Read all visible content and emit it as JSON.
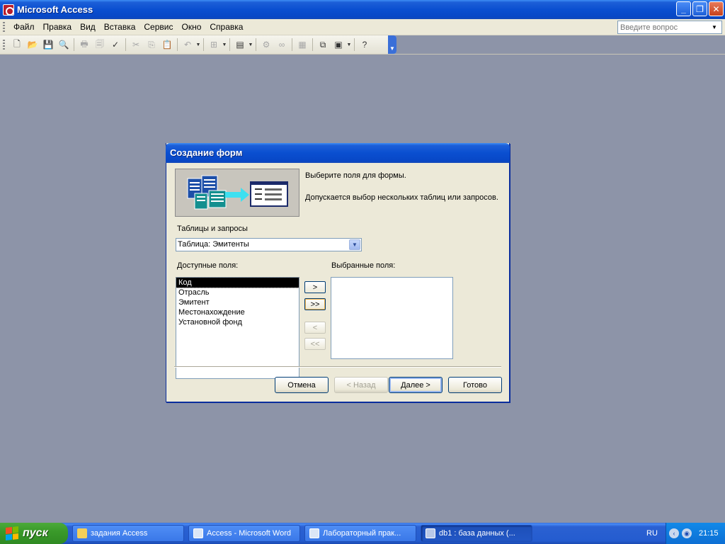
{
  "window": {
    "title": "Microsoft Access"
  },
  "menu": {
    "items": [
      "Файл",
      "Правка",
      "Вид",
      "Вставка",
      "Сервис",
      "Окно",
      "Справка"
    ],
    "help_placeholder": "Введите вопрос"
  },
  "dialog": {
    "title": "Создание форм",
    "instruction1": "Выберите поля для формы.",
    "instruction2": "Допускается выбор нескольких таблиц или запросов.",
    "tables_label": "Таблицы и запросы",
    "selected_table": "Таблица: Эмитенты",
    "available_label": "Доступные поля:",
    "selected_label": "Выбранные поля:",
    "available_fields": [
      "Код",
      "Отрасль",
      "Эмитент",
      "Местонахождение",
      "Установной фонд"
    ],
    "selected_fields": [],
    "move_buttons": {
      "add_one": ">",
      "add_all": ">>",
      "remove_one": "<",
      "remove_all": "<<"
    },
    "buttons": {
      "cancel": "Отмена",
      "back": "< Назад",
      "next": "Далее >",
      "finish": "Готово"
    }
  },
  "taskbar": {
    "start": "пуск",
    "tasks": [
      "задания Access",
      "Access - Microsoft Word",
      "Лабораторный прак...",
      "db1 : база данных (..."
    ],
    "language": "RU",
    "clock": "21:15"
  },
  "colors": {
    "title_blue": "#0a4fd0",
    "desktop": "#8d94a8",
    "dialog_bg": "#ece9d8"
  }
}
